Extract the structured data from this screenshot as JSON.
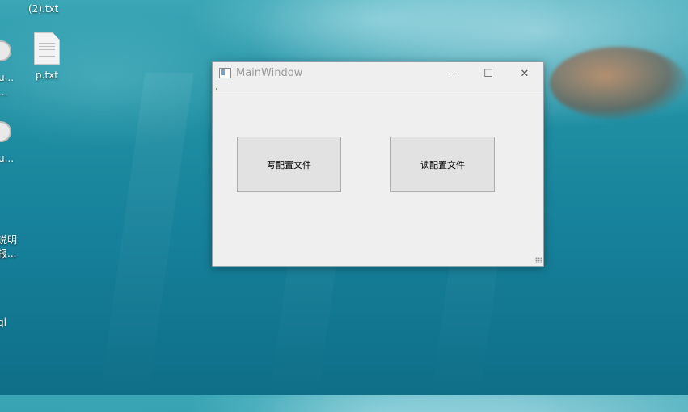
{
  "desktop": {
    "icons": [
      {
        "label": "(2).txt"
      },
      {
        "label": "p.txt"
      },
      {
        "label": "u..."
      },
      {
        "label": "..."
      },
      {
        "label": "u..."
      },
      {
        "label": "说明"
      },
      {
        "label": "报..."
      },
      {
        "label": "ql"
      }
    ]
  },
  "window": {
    "title": "MainWindow",
    "controls": {
      "minimize": "—",
      "maximize": "☐",
      "close": "✕"
    },
    "buttons": {
      "write_config": "写配置文件",
      "read_config": "读配置文件"
    }
  }
}
